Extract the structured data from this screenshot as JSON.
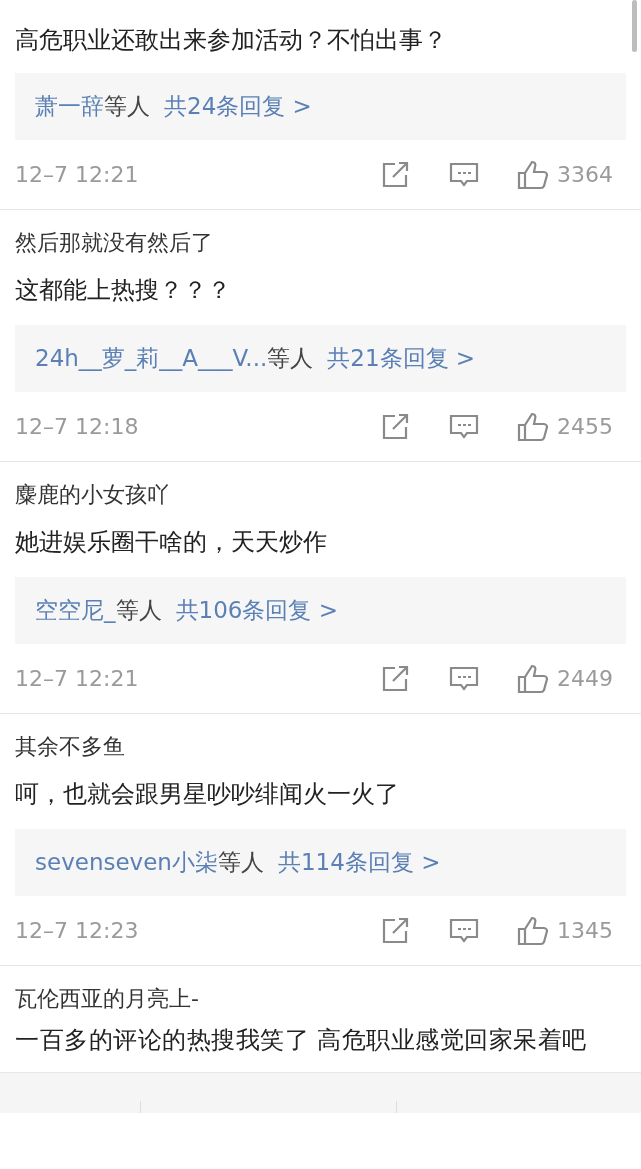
{
  "comments": [
    {
      "text": "高危职业还敢出来参加活动？不怕出事？",
      "reply": {
        "users": "萧一辞",
        "suffix": "等人",
        "count": "共24条回复 >"
      },
      "time": "12–7 12:21",
      "likes": "3364"
    },
    {
      "username": "然后那就没有然后了",
      "text": "这都能上热搜？？？",
      "reply": {
        "users": "24h__萝_莉__A___V...",
        "suffix": "等人",
        "count": "共21条回复 >"
      },
      "time": "12–7 12:18",
      "likes": "2455"
    },
    {
      "username": "麋鹿的小女孩吖",
      "text": "她进娱乐圈干啥的，天天炒作",
      "reply": {
        "users": "空空尼_",
        "suffix": "等人",
        "count": "共106条回复 >"
      },
      "time": "12–7 12:21",
      "likes": "2449"
    },
    {
      "username": "其余不多鱼",
      "text": "呵，也就会跟男星吵吵绯闻火一火了",
      "reply": {
        "users": "sevenseven小柒",
        "suffix": "等人",
        "count": "共114条回复 >"
      },
      "time": "12–7 12:23",
      "likes": "1345"
    },
    {
      "username": "瓦伦西亚的月亮上-",
      "text": "一百多的评论的热搜我笑了   高危职业感觉回家呆着吧"
    }
  ]
}
